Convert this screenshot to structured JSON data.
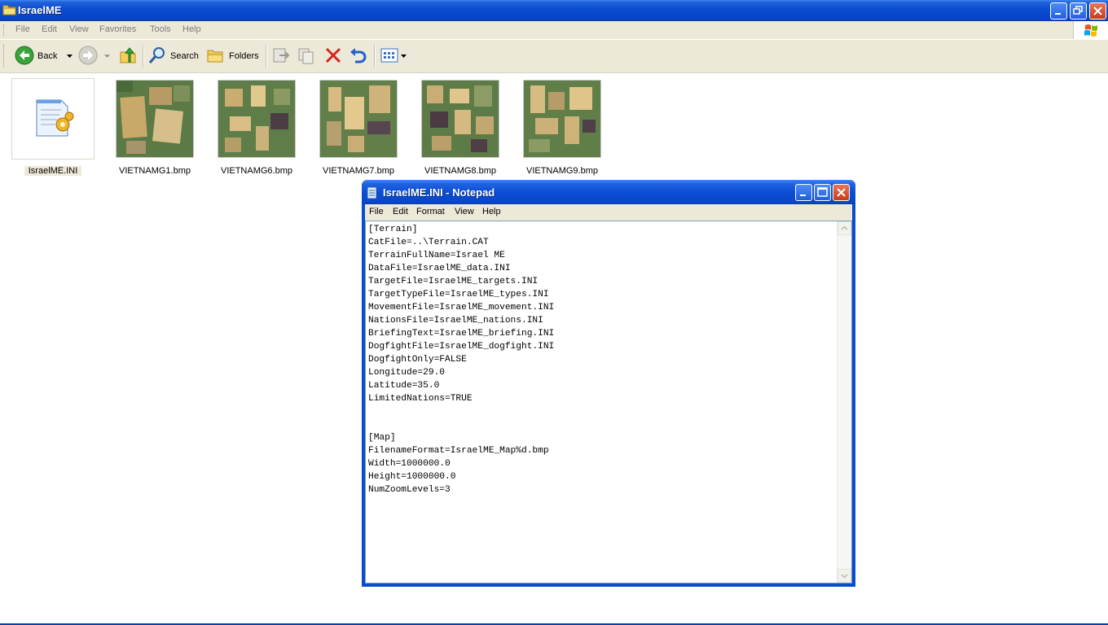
{
  "explorer": {
    "title": "IsraelME",
    "menu": [
      "File",
      "Edit",
      "View",
      "Favorites",
      "Tools",
      "Help"
    ],
    "toolbar": {
      "back_label": "Back",
      "search_label": "Search",
      "folders_label": "Folders"
    },
    "files": [
      {
        "name": "IsraelME.INI",
        "icon": "ini-settings-file-icon",
        "selected": true
      },
      {
        "name": "VIETNAMG1.bmp",
        "icon": "bmp-thumbnail"
      },
      {
        "name": "VIETNAMG6.bmp",
        "icon": "bmp-thumbnail"
      },
      {
        "name": "VIETNAMG7.bmp",
        "icon": "bmp-thumbnail"
      },
      {
        "name": "VIETNAMG8.bmp",
        "icon": "bmp-thumbnail"
      },
      {
        "name": "VIETNAMG9.bmp",
        "icon": "bmp-thumbnail"
      }
    ]
  },
  "notepad": {
    "title": "IsraelME.INI - Notepad",
    "menu": [
      "File",
      "Edit",
      "Format",
      "View",
      "Help"
    ],
    "lines": [
      "[Terrain]",
      "CatFile=..\\Terrain.CAT",
      "TerrainFullName=Israel ME",
      "DataFile=IsraelME_data.INI",
      "TargetFile=IsraelME_targets.INI",
      "TargetTypeFile=IsraelME_types.INI",
      "MovementFile=IsraelME_movement.INI",
      "NationsFile=IsraelME_nations.INI",
      "BriefingText=IsraelME_briefing.INI",
      "DogfightFile=IsraelME_dogfight.INI",
      "DogfightOnly=FALSE",
      "Longitude=29.0",
      "Latitude=35.0",
      "LimitedNations=TRUE",
      "",
      "",
      "[Map]",
      "FilenameFormat=IsraelME_Map%d.bmp",
      "Width=1000000.0",
      "Height=1000000.0",
      "NumZoomLevels=3"
    ]
  },
  "colors": {
    "titlebar_blue": "#0a4cd0",
    "close_red": "#c93a18",
    "chrome_beige": "#ece9d8"
  }
}
